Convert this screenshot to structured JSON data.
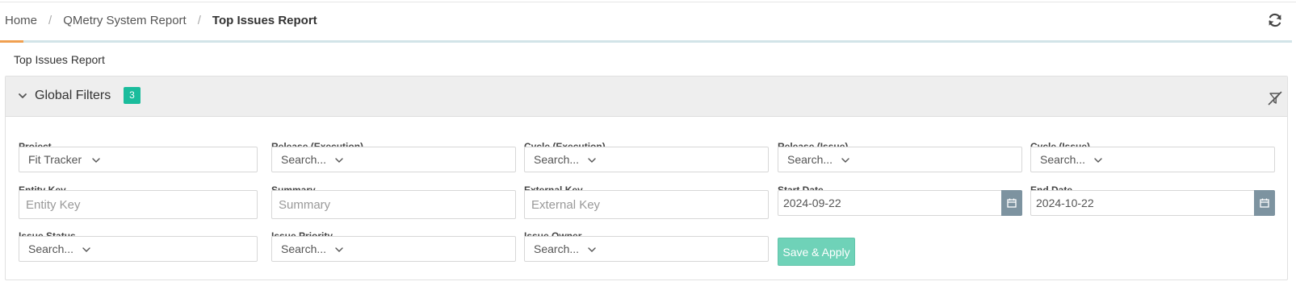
{
  "breadcrumb": {
    "items": [
      "Home",
      "QMetry System Report"
    ],
    "separator": "/",
    "current": "Top Issues Report"
  },
  "progress": {
    "fraction": 0.018
  },
  "page_title": "Top Issues Report",
  "global_filters": {
    "label": "Global Filters",
    "count": "3"
  },
  "fields": {
    "project": {
      "label": "Project",
      "value": "Fit Tracker"
    },
    "release_execution": {
      "label": "Release (Execution)",
      "value": "Search..."
    },
    "cycle_execution": {
      "label": "Cycle (Execution)",
      "value": "Search..."
    },
    "release_issue": {
      "label": "Release (Issue)",
      "value": "Search..."
    },
    "cycle_issue": {
      "label": "Cycle (Issue)",
      "value": "Search..."
    },
    "entity_key": {
      "label": "Entity Key",
      "placeholder": "Entity Key"
    },
    "summary": {
      "label": "Summary",
      "placeholder": "Summary"
    },
    "external_key": {
      "label": "External Key",
      "placeholder": "External Key"
    },
    "start_date": {
      "label": "Start Date",
      "value": "2024-09-22"
    },
    "end_date": {
      "label": "End Date",
      "value": "2024-10-22"
    },
    "issue_status": {
      "label": "Issue Status",
      "value": "Search..."
    },
    "issue_priority": {
      "label": "Issue Priority",
      "value": "Search..."
    },
    "issue_owner": {
      "label": "Issue Owner",
      "value": "Search..."
    }
  },
  "save_apply_label": "Save & Apply",
  "icons": {
    "refresh": "refresh-icon",
    "collapse": "chevron-down-icon",
    "clear_filters": "filter-clear-icon",
    "calendar": "calendar-icon",
    "dropdown": "chevron-down-icon"
  },
  "colors": {
    "accent": "#1abc9c",
    "button": "#6fd2b8",
    "calendar_button": "#7d93a0",
    "progress": "#f0a050"
  }
}
